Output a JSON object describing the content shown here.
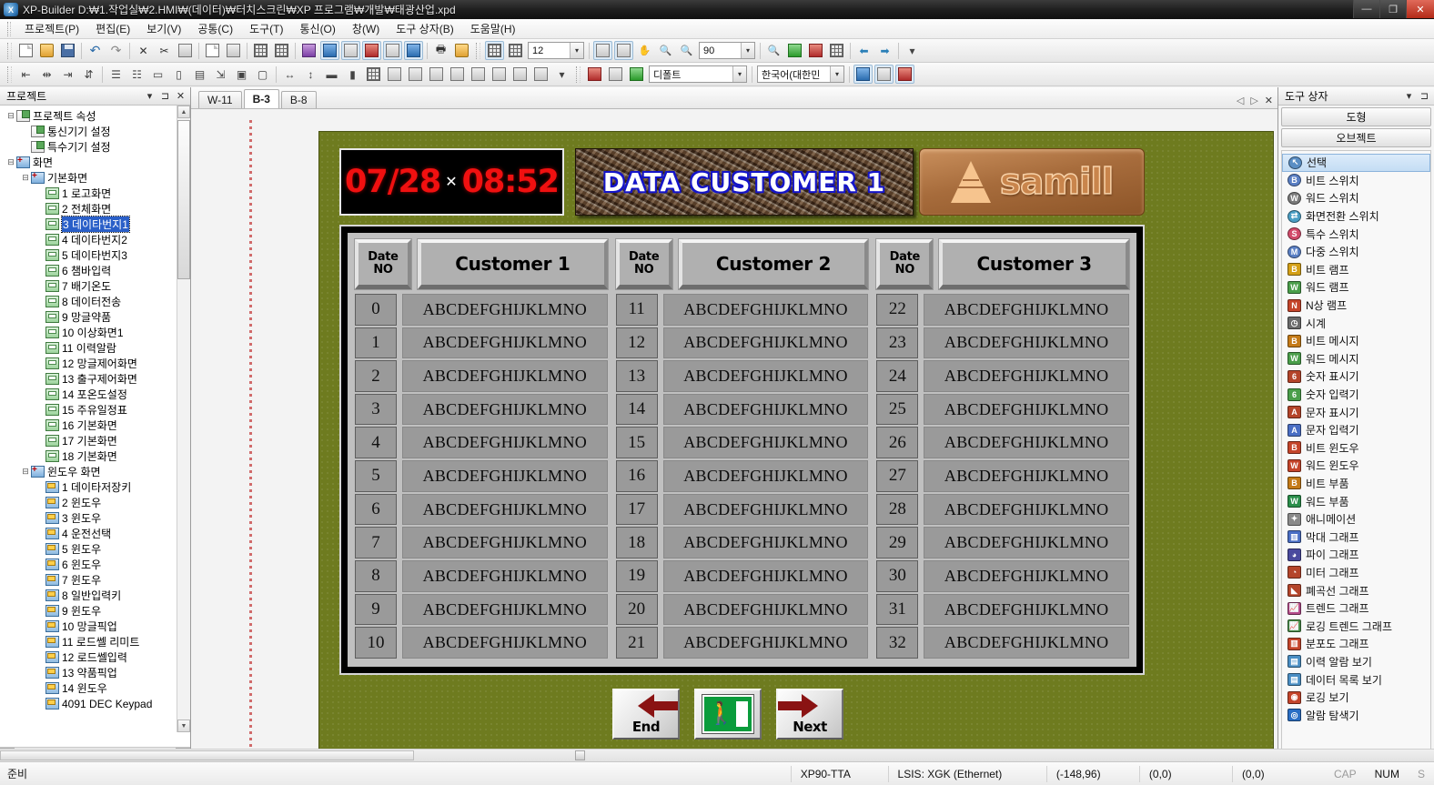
{
  "window": {
    "title": "XP-Builder  D:₩1.작업실₩2.HMI₩(데이터)₩터치스크린₩XP 프로그램₩개발₩태광산업.xpd",
    "minimize": "—",
    "maximize": "❐",
    "close": "✕"
  },
  "menu": {
    "items": [
      "프로젝트(P)",
      "편집(E)",
      "보기(V)",
      "공통(C)",
      "도구(T)",
      "통신(O)",
      "창(W)",
      "도구 상자(B)",
      "도움말(H)"
    ]
  },
  "toolbar": {
    "font_size": "12",
    "zoom_level": "90",
    "style_default": "디폴트",
    "language": "한국어(대한민",
    "dropdown_arrow": "▾"
  },
  "project_panel": {
    "title": "프로젝트",
    "menu_icon": "▾",
    "pin_icon": "⊐",
    "close_icon": "✕",
    "tree": [
      {
        "label": "프로젝트 속성",
        "depth": 0,
        "icon": "property-icon",
        "twist": "⊟"
      },
      {
        "label": "통신기기 설정",
        "depth": 1,
        "icon": "property-icon",
        "twist": ""
      },
      {
        "label": "특수기기 설정",
        "depth": 1,
        "icon": "property-icon",
        "twist": ""
      },
      {
        "label": "화면",
        "depth": 0,
        "icon": "screen-folder-icon",
        "twist": "⊟"
      },
      {
        "label": "기본화면",
        "depth": 1,
        "icon": "screen-folder-icon",
        "twist": "⊟"
      },
      {
        "label": "1 로고화면",
        "depth": 2,
        "icon": "base-screen-icon",
        "twist": ""
      },
      {
        "label": "2 전체화면",
        "depth": 2,
        "icon": "base-screen-icon",
        "twist": ""
      },
      {
        "label": "3 데이타번지1",
        "depth": 2,
        "icon": "base-screen-icon",
        "twist": "",
        "selected": true
      },
      {
        "label": "4 데이타번지2",
        "depth": 2,
        "icon": "base-screen-icon",
        "twist": ""
      },
      {
        "label": "5 데이타번지3",
        "depth": 2,
        "icon": "base-screen-icon",
        "twist": ""
      },
      {
        "label": "6 챔바입력",
        "depth": 2,
        "icon": "base-screen-icon",
        "twist": ""
      },
      {
        "label": "7 배기온도",
        "depth": 2,
        "icon": "base-screen-icon",
        "twist": ""
      },
      {
        "label": "8 데이터전송",
        "depth": 2,
        "icon": "base-screen-icon",
        "twist": ""
      },
      {
        "label": "9 망글약품",
        "depth": 2,
        "icon": "base-screen-icon",
        "twist": ""
      },
      {
        "label": "10 이상화면1",
        "depth": 2,
        "icon": "base-screen-icon",
        "twist": ""
      },
      {
        "label": "11 이력알람",
        "depth": 2,
        "icon": "base-screen-icon",
        "twist": ""
      },
      {
        "label": "12 망글제어화면",
        "depth": 2,
        "icon": "base-screen-icon",
        "twist": ""
      },
      {
        "label": "13 출구제어화면",
        "depth": 2,
        "icon": "base-screen-icon",
        "twist": ""
      },
      {
        "label": "14 포온도설정",
        "depth": 2,
        "icon": "base-screen-icon",
        "twist": ""
      },
      {
        "label": "15 주유일정표",
        "depth": 2,
        "icon": "base-screen-icon",
        "twist": ""
      },
      {
        "label": "16 기본화면",
        "depth": 2,
        "icon": "base-screen-icon",
        "twist": ""
      },
      {
        "label": "17 기본화면",
        "depth": 2,
        "icon": "base-screen-icon",
        "twist": ""
      },
      {
        "label": "18 기본화면",
        "depth": 2,
        "icon": "base-screen-icon",
        "twist": ""
      },
      {
        "label": "윈도우 화면",
        "depth": 1,
        "icon": "window-folder-icon",
        "twist": "⊟"
      },
      {
        "label": "1 데이타저장키",
        "depth": 2,
        "icon": "window-screen-icon",
        "twist": ""
      },
      {
        "label": "2 윈도우",
        "depth": 2,
        "icon": "window-screen-icon",
        "twist": ""
      },
      {
        "label": "3 윈도우",
        "depth": 2,
        "icon": "window-screen-icon",
        "twist": ""
      },
      {
        "label": "4 운전선택",
        "depth": 2,
        "icon": "window-screen-icon",
        "twist": ""
      },
      {
        "label": "5 윈도우",
        "depth": 2,
        "icon": "window-screen-icon",
        "twist": ""
      },
      {
        "label": "6 윈도우",
        "depth": 2,
        "icon": "window-screen-icon",
        "twist": ""
      },
      {
        "label": "7 윈도우",
        "depth": 2,
        "icon": "window-screen-icon",
        "twist": ""
      },
      {
        "label": "8 일반입력키",
        "depth": 2,
        "icon": "window-screen-icon",
        "twist": ""
      },
      {
        "label": "9 윈도우",
        "depth": 2,
        "icon": "window-screen-icon",
        "twist": ""
      },
      {
        "label": "10 망글픽업",
        "depth": 2,
        "icon": "window-screen-icon",
        "twist": ""
      },
      {
        "label": "11 로드쎌 리미트",
        "depth": 2,
        "icon": "window-screen-icon",
        "twist": ""
      },
      {
        "label": "12 로드쎌입력",
        "depth": 2,
        "icon": "window-screen-icon",
        "twist": ""
      },
      {
        "label": "13 약품픽업",
        "depth": 2,
        "icon": "window-screen-icon",
        "twist": ""
      },
      {
        "label": "14 윈도우",
        "depth": 2,
        "icon": "window-screen-icon",
        "twist": ""
      },
      {
        "label": "4091 DEC Keypad",
        "depth": 2,
        "icon": "window-screen-icon",
        "twist": ""
      }
    ]
  },
  "tabs": {
    "items": [
      {
        "label": "W-11",
        "active": false
      },
      {
        "label": "B-3",
        "active": true
      },
      {
        "label": "B-8",
        "active": false
      }
    ],
    "nav_prev": "◁",
    "nav_next": "▷",
    "nav_close": "✕"
  },
  "hmi": {
    "clock": {
      "date": "07/28",
      "separator": "✕",
      "time": "08:52"
    },
    "title": "DATA  CUSTOMER 1",
    "logo": "samill",
    "table": {
      "columns": [
        {
          "date_header": "Date\nNO",
          "date_header_line1": "Date",
          "date_header_line2": "NO",
          "name_header": "Customer 1",
          "rows": [
            {
              "no": "0",
              "value": "ABCDEFGHIJKLMNO"
            },
            {
              "no": "1",
              "value": "ABCDEFGHIJKLMNO"
            },
            {
              "no": "2",
              "value": "ABCDEFGHIJKLMNO"
            },
            {
              "no": "3",
              "value": "ABCDEFGHIJKLMNO"
            },
            {
              "no": "4",
              "value": "ABCDEFGHIJKLMNO"
            },
            {
              "no": "5",
              "value": "ABCDEFGHIJKLMNO"
            },
            {
              "no": "6",
              "value": "ABCDEFGHIJKLMNO"
            },
            {
              "no": "7",
              "value": "ABCDEFGHIJKLMNO"
            },
            {
              "no": "8",
              "value": "ABCDEFGHIJKLMNO"
            },
            {
              "no": "9",
              "value": "ABCDEFGHIJKLMNO"
            },
            {
              "no": "10",
              "value": "ABCDEFGHIJKLMNO"
            }
          ]
        },
        {
          "date_header_line1": "Date",
          "date_header_line2": "NO",
          "name_header": "Customer 2",
          "rows": [
            {
              "no": "11",
              "value": "ABCDEFGHIJKLMNO"
            },
            {
              "no": "12",
              "value": "ABCDEFGHIJKLMNO"
            },
            {
              "no": "13",
              "value": "ABCDEFGHIJKLMNO"
            },
            {
              "no": "14",
              "value": "ABCDEFGHIJKLMNO"
            },
            {
              "no": "15",
              "value": "ABCDEFGHIJKLMNO"
            },
            {
              "no": "16",
              "value": "ABCDEFGHIJKLMNO"
            },
            {
              "no": "17",
              "value": "ABCDEFGHIJKLMNO"
            },
            {
              "no": "18",
              "value": "ABCDEFGHIJKLMNO"
            },
            {
              "no": "19",
              "value": "ABCDEFGHIJKLMNO"
            },
            {
              "no": "20",
              "value": "ABCDEFGHIJKLMNO"
            },
            {
              "no": "21",
              "value": "ABCDEFGHIJKLMNO"
            }
          ]
        },
        {
          "date_header_line1": "Date",
          "date_header_line2": "NO",
          "name_header": "Customer 3",
          "rows": [
            {
              "no": "22",
              "value": "ABCDEFGHIJKLMNO"
            },
            {
              "no": "23",
              "value": "ABCDEFGHIJKLMNO"
            },
            {
              "no": "24",
              "value": "ABCDEFGHIJKLMNO"
            },
            {
              "no": "25",
              "value": "ABCDEFGHIJKLMNO"
            },
            {
              "no": "26",
              "value": "ABCDEFGHIJKLMNO"
            },
            {
              "no": "27",
              "value": "ABCDEFGHIJKLMNO"
            },
            {
              "no": "28",
              "value": "ABCDEFGHIJKLMNO"
            },
            {
              "no": "29",
              "value": "ABCDEFGHIJKLMNO"
            },
            {
              "no": "30",
              "value": "ABCDEFGHIJKLMNO"
            },
            {
              "no": "31",
              "value": "ABCDEFGHIJKLMNO"
            },
            {
              "no": "32",
              "value": "ABCDEFGHIJKLMNO"
            }
          ]
        }
      ]
    },
    "buttons": {
      "end": "End",
      "next": "Next",
      "exit_runner": "🚶",
      "exit_arrow": "→"
    },
    "colors": {
      "canvas_background": "#6e7b1f",
      "clock_text": "#f01010",
      "title_text": "#ffffff",
      "title_outline": "#1414c8",
      "arrow_red": "#8a1313",
      "exit_green": "#0a9c3c"
    }
  },
  "toolbox": {
    "title": "도구 상자",
    "menu_icon": "▾",
    "pin_icon": "⊐",
    "section_shapes": "도형",
    "section_objects": "오브젝트",
    "items": [
      {
        "label": "선택",
        "icon": "select-icon",
        "color": "#5a8ec4",
        "glyph": "↖",
        "selected": true
      },
      {
        "label": "비트 스위치",
        "icon": "bit-switch-icon",
        "color": "#5a7fc4",
        "glyph": "B"
      },
      {
        "label": "워드 스위치",
        "icon": "word-switch-icon",
        "color": "#7a7a7a",
        "glyph": "W"
      },
      {
        "label": "화면전환 스위치",
        "icon": "screen-change-switch-icon",
        "color": "#4a9ec4",
        "glyph": "⇄"
      },
      {
        "label": "특수 스위치",
        "icon": "special-switch-icon",
        "color": "#d24a6a",
        "glyph": "S"
      },
      {
        "label": "다중 스위치",
        "icon": "multi-switch-icon",
        "color": "#5a7fc4",
        "glyph": "M"
      },
      {
        "label": "비트 램프",
        "icon": "bit-lamp-icon",
        "color": "#d4a017",
        "glyph": "B"
      },
      {
        "label": "워드 램프",
        "icon": "word-lamp-icon",
        "color": "#4a9e4a",
        "glyph": "W"
      },
      {
        "label": "N상 램프",
        "icon": "n-lamp-icon",
        "color": "#c4442a",
        "glyph": "N"
      },
      {
        "label": "시계",
        "icon": "clock-icon",
        "color": "#6a6a6a",
        "glyph": "◷"
      },
      {
        "label": "비트 메시지",
        "icon": "bit-message-icon",
        "color": "#c47a17",
        "glyph": "B"
      },
      {
        "label": "워드 메시지",
        "icon": "word-message-icon",
        "color": "#4a9e4a",
        "glyph": "W"
      },
      {
        "label": "숫자 표시기",
        "icon": "numeric-display-icon",
        "color": "#b4442a",
        "glyph": "6"
      },
      {
        "label": "숫자 입력기",
        "icon": "numeric-input-icon",
        "color": "#4a9e4a",
        "glyph": "6"
      },
      {
        "label": "문자 표시기",
        "icon": "text-display-icon",
        "color": "#b4442a",
        "glyph": "A"
      },
      {
        "label": "문자 입력기",
        "icon": "text-input-icon",
        "color": "#4a6ec4",
        "glyph": "A"
      },
      {
        "label": "비트 윈도우",
        "icon": "bit-window-icon",
        "color": "#c4442a",
        "glyph": "B"
      },
      {
        "label": "워드 윈도우",
        "icon": "word-window-icon",
        "color": "#c4442a",
        "glyph": "W"
      },
      {
        "label": "비트 부품",
        "icon": "bit-part-icon",
        "color": "#c47a17",
        "glyph": "B"
      },
      {
        "label": "워드 부품",
        "icon": "word-part-icon",
        "color": "#2a8e4a",
        "glyph": "W"
      },
      {
        "label": "애니메이션",
        "icon": "animation-icon",
        "color": "#8a8a8a",
        "glyph": "✦"
      },
      {
        "label": "막대 그래프",
        "icon": "bar-graph-icon",
        "color": "#4a6ec4",
        "glyph": "▥"
      },
      {
        "label": "파이 그래프",
        "icon": "pie-graph-icon",
        "color": "#4a4a9e",
        "glyph": "◕"
      },
      {
        "label": "미터 그래프",
        "icon": "meter-graph-icon",
        "color": "#b4442a",
        "glyph": "◔"
      },
      {
        "label": "폐곡선 그래프",
        "icon": "closed-curve-graph-icon",
        "color": "#b4442a",
        "glyph": "◣"
      },
      {
        "label": "트렌드 그래프",
        "icon": "trend-graph-icon",
        "color": "#b44a8a",
        "glyph": "📈"
      },
      {
        "label": "로깅 트렌드 그래프",
        "icon": "logging-trend-graph-icon",
        "color": "#4a8e4a",
        "glyph": "📈"
      },
      {
        "label": "분포도 그래프",
        "icon": "distribution-graph-icon",
        "color": "#c4442a",
        "glyph": "▥"
      },
      {
        "label": "이력 알람 보기",
        "icon": "history-alarm-view-icon",
        "color": "#4a8ec4",
        "glyph": "▤"
      },
      {
        "label": "데이터 목록 보기",
        "icon": "data-list-view-icon",
        "color": "#4a8ec4",
        "glyph": "▤"
      },
      {
        "label": "로깅 보기",
        "icon": "logging-view-icon",
        "color": "#c4442a",
        "glyph": "◉"
      },
      {
        "label": "알람 탐색기",
        "icon": "alarm-explorer-icon",
        "color": "#2a6ec4",
        "glyph": "◎"
      }
    ]
  },
  "statusbar": {
    "ready": "준비",
    "device": "XP90-TTA",
    "plc": "LSIS: XGK (Ethernet)",
    "coord1": "(-148,96)",
    "coord2": "(0,0)",
    "coord3": "(0,0)",
    "cap": "CAP",
    "num": "NUM",
    "scrl": "S"
  }
}
